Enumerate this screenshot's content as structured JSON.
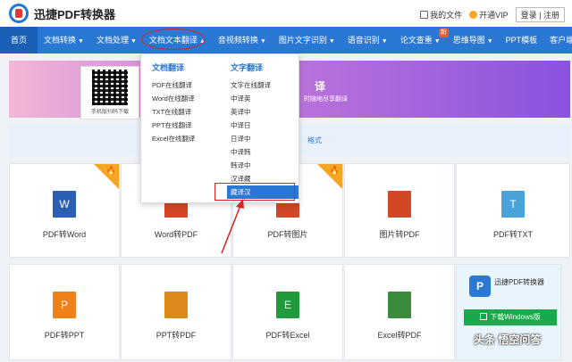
{
  "header": {
    "logo_text": "迅捷PDF转换器",
    "my_files": "我的文件",
    "open_vip": "开通VIP",
    "login": "登录",
    "register": "注册",
    "auth_sep": "|"
  },
  "nav": {
    "items": [
      {
        "label": "首页",
        "arrow": ""
      },
      {
        "label": "文档转换",
        "arrow": "▼"
      },
      {
        "label": "文档处理",
        "arrow": "▼"
      },
      {
        "label": "文档文本翻译",
        "arrow": "▲"
      },
      {
        "label": "音视频转换",
        "arrow": "▼"
      },
      {
        "label": "图片文字识别",
        "arrow": "▼"
      },
      {
        "label": "语音识别",
        "arrow": "▼"
      },
      {
        "label": "论文查重",
        "arrow": "▼"
      },
      {
        "label": "思维导图",
        "arrow": "▼"
      },
      {
        "label": "PPT模板",
        "arrow": ""
      },
      {
        "label": "客户端",
        "arrow": "▼"
      }
    ],
    "new_badge": "新"
  },
  "banner": {
    "qr_caption": "手机版扫码下载",
    "headline": "译",
    "subline": "时随地尽享翻译"
  },
  "format_bar": {
    "text": "格式"
  },
  "dropdown": {
    "doc_head": "文档翻译",
    "doc_items": [
      "PDF在线翻译",
      "Word在线翻译",
      "TXT在线翻译",
      "PPT在线翻译",
      "Excel在线翻译"
    ],
    "text_head": "文字翻译",
    "text_items": [
      "文字在线翻译",
      "中译英",
      "英译中",
      "中译日",
      "日译中",
      "中译韩",
      "韩译中",
      "汉译藏",
      "藏译汉"
    ],
    "selected_index": 8
  },
  "tools": {
    "row1": [
      {
        "label": "PDF转Word",
        "glyph": "W",
        "color": "#2b5fb4",
        "hot": true
      },
      {
        "label": "Word转PDF",
        "glyph": "",
        "color": "#d24726",
        "hot": false
      },
      {
        "label": "PDF转图片",
        "glyph": "",
        "color": "#d24726",
        "hot": true
      },
      {
        "label": "图片转PDF",
        "glyph": "",
        "color": "#d24726",
        "hot": false
      },
      {
        "label": "PDF转TXT",
        "glyph": "T",
        "color": "#4aa3d8",
        "hot": false
      }
    ],
    "row2": [
      {
        "label": "PDF转PPT",
        "glyph": "P",
        "color": "#f0801a"
      },
      {
        "label": "PPT转PDF",
        "glyph": "",
        "color": "#d98a1a"
      },
      {
        "label": "PDF转Excel",
        "glyph": "E",
        "color": "#1f9b3c"
      },
      {
        "label": "Excel转PDF",
        "glyph": "",
        "color": "#3c8a3c"
      }
    ],
    "hot_glyph": "🔥"
  },
  "download": {
    "title": "迅捷PDF转换器",
    "logo_glyph": "P",
    "button": "下载Windows版"
  },
  "watermark": "头条 悟空问答",
  "colors": {
    "nav_blue": "#2b78d4",
    "highlight_red": "#e02020"
  }
}
